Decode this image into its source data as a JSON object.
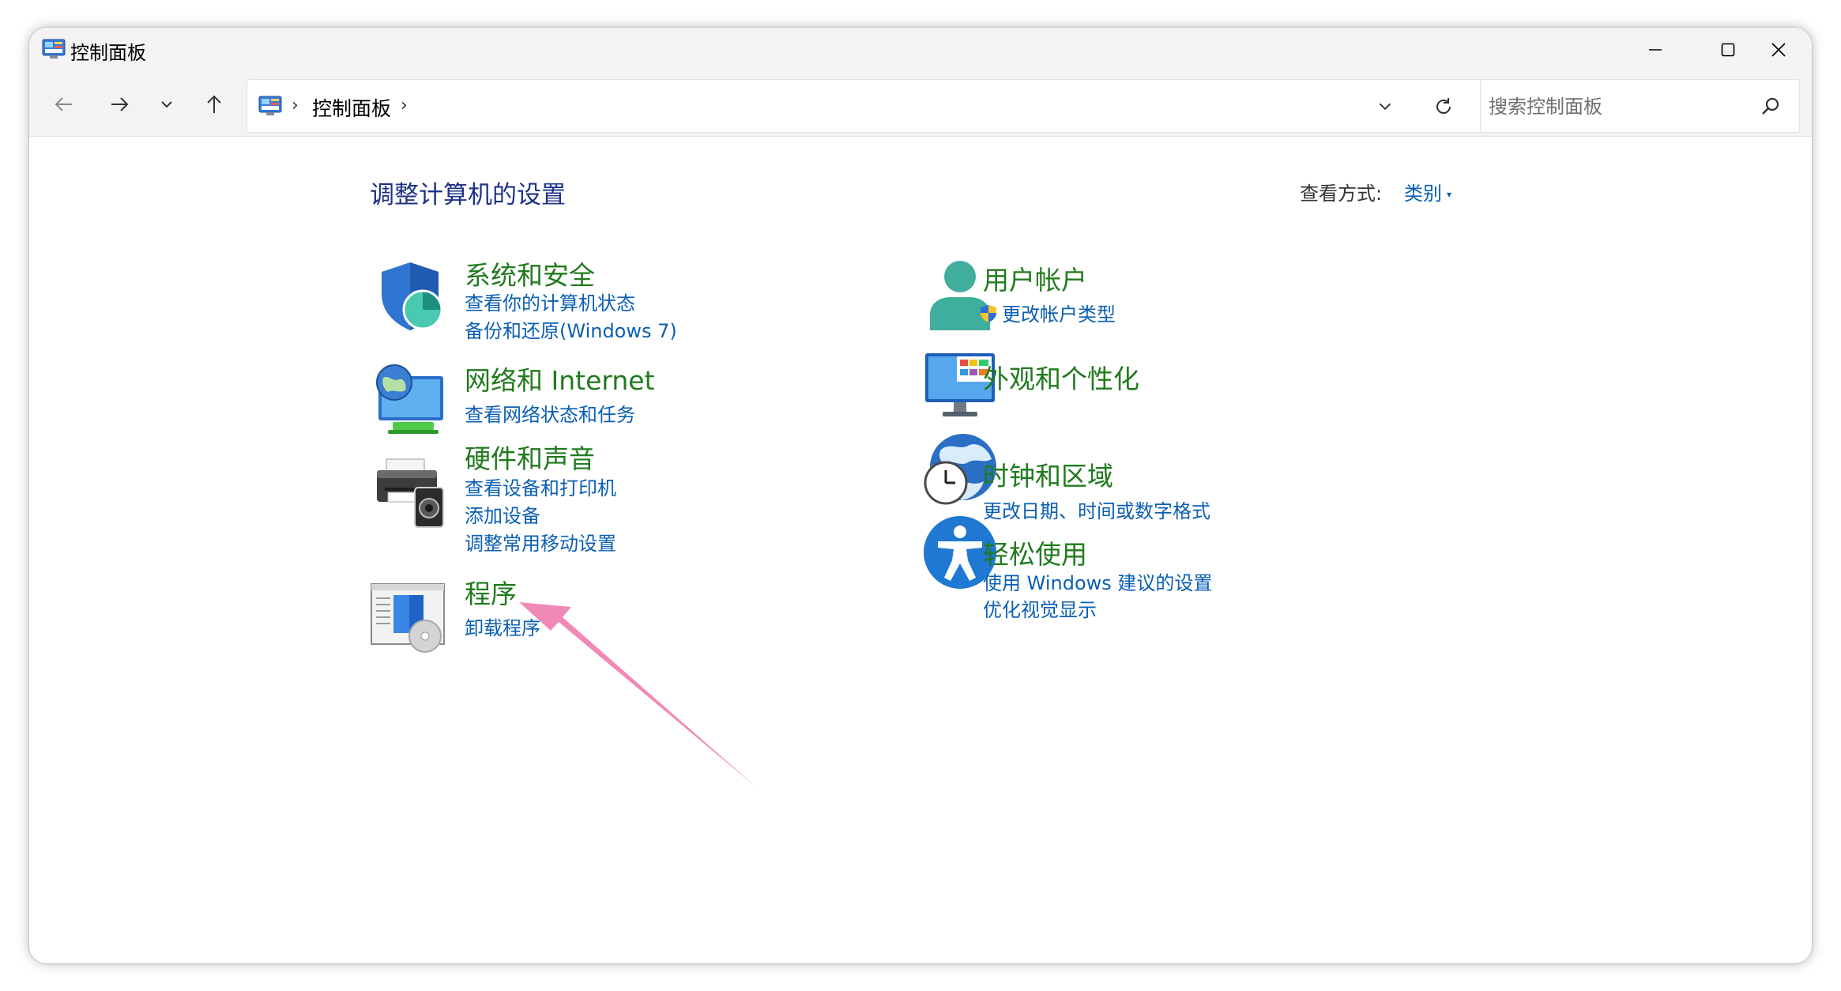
{
  "window": {
    "title": "控制面板",
    "buttons": [
      "minimize",
      "maximize",
      "close"
    ]
  },
  "navigation": {
    "breadcrumb": [
      "控制面板"
    ],
    "search": {
      "placeholder": "搜索控制面板",
      "value": ""
    }
  },
  "content": {
    "title": "调整计算机的设置",
    "view_by_label": "查看方式:",
    "view_by_value": "类别"
  },
  "categories": {
    "system_security": {
      "title": "系统和安全",
      "icon": "shield-icon",
      "links": [
        "查看你的计算机状态",
        "备份和还原(Windows 7)"
      ]
    },
    "network": {
      "title": "网络和 Internet",
      "icon": "network-globe-icon",
      "links": [
        "查看网络状态和任务"
      ]
    },
    "hardware_sound": {
      "title": "硬件和声音",
      "icon": "printer-speaker-icon",
      "links": [
        "查看设备和打印机",
        "添加设备",
        "调整常用移动设置"
      ]
    },
    "programs": {
      "title": "程序",
      "icon": "programs-icon",
      "links": [
        "卸载程序"
      ]
    },
    "user_accounts": {
      "title": "用户帐户",
      "icon": "user-icon",
      "links": [
        "更改帐户类型"
      ]
    },
    "appearance": {
      "title": "外观和个性化",
      "icon": "monitor-personalize-icon",
      "links": []
    },
    "clock_region": {
      "title": "时钟和区域",
      "icon": "clock-globe-icon",
      "links": [
        "更改日期、时间或数字格式"
      ]
    },
    "ease_of_access": {
      "title": "轻松使用",
      "icon": "accessibility-icon",
      "links": [
        "使用 Windows 建议的设置",
        "优化视觉显示"
      ]
    }
  },
  "annotation": {
    "arrow_color": "#f07fb0"
  },
  "colors": {
    "category_title": "#217a1e",
    "link": "#0b5fb3",
    "page_title": "#1e3287"
  }
}
